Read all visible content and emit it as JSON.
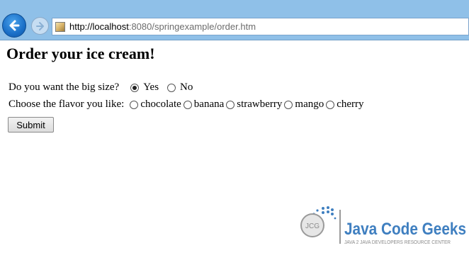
{
  "browser": {
    "url_host": "http://localhost",
    "url_rest": ":8080/springexample/order.htm"
  },
  "page": {
    "title": "Order your ice cream!",
    "big_size": {
      "label": "Do you want the big size?",
      "options": [
        {
          "label": "Yes",
          "checked": true
        },
        {
          "label": "No",
          "checked": false
        }
      ]
    },
    "flavor": {
      "label": "Choose the flavor you like:",
      "options": [
        {
          "label": "chocolate"
        },
        {
          "label": "banana"
        },
        {
          "label": "strawberry"
        },
        {
          "label": "mango"
        },
        {
          "label": "cherry"
        }
      ]
    },
    "submit_label": "Submit"
  },
  "logo": {
    "badge_text": "JCG",
    "name": "Java Code Geeks",
    "tagline": "JAVA 2 JAVA DEVELOPERS RESOURCE CENTER"
  },
  "colors": {
    "chrome": "#8fc0e8",
    "logo_blue": "#3f7fc0"
  }
}
